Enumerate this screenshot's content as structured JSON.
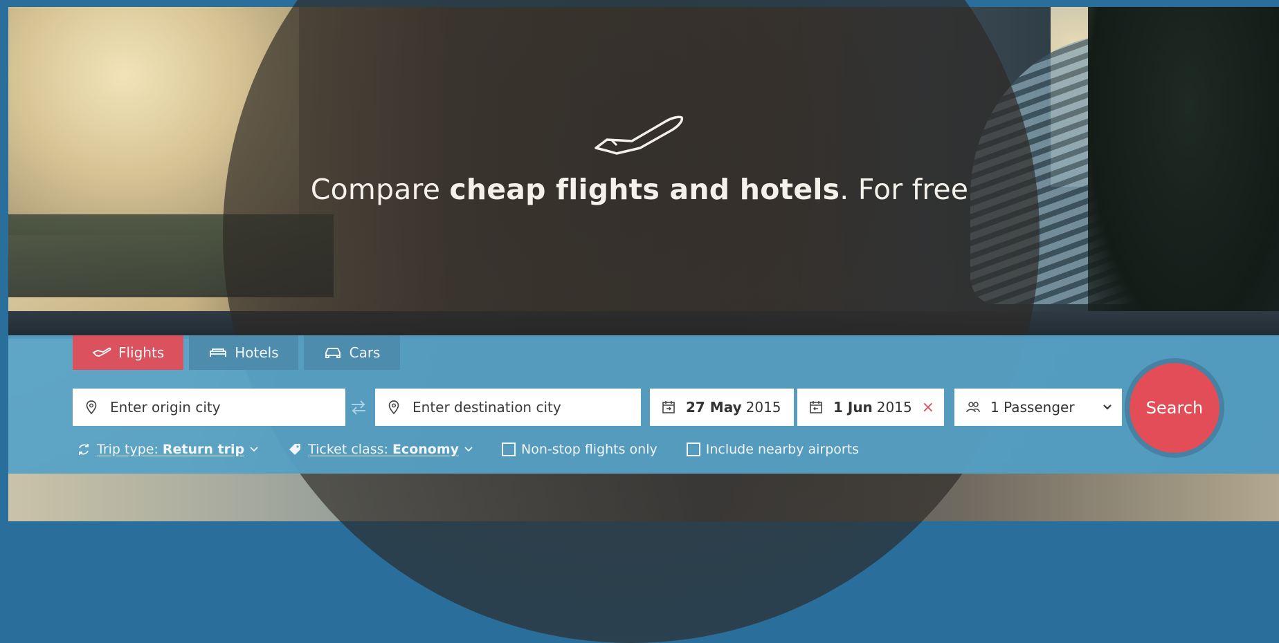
{
  "hero": {
    "headline_light_1": "Compare ",
    "headline_bold": "cheap flights and hotels",
    "headline_light_2": ". For free"
  },
  "tabs": [
    {
      "label": "Flights",
      "icon": "plane-icon",
      "active": true
    },
    {
      "label": "Hotels",
      "icon": "bed-icon",
      "active": false
    },
    {
      "label": "Cars",
      "icon": "car-icon",
      "active": false
    }
  ],
  "search": {
    "origin_placeholder": "Enter origin city",
    "destination_placeholder": "Enter destination city",
    "depart_day": "27 May",
    "depart_year": "2015",
    "return_day": "1 Jun",
    "return_year": "2015",
    "clear_symbol": "×",
    "passengers": "1 Passenger",
    "search_label": "Search"
  },
  "options": {
    "trip_type_prefix": "Trip type: ",
    "trip_type_value": "Return trip",
    "ticket_class_prefix": "Ticket class: ",
    "ticket_class_value": "Economy",
    "nonstop_label": "Non-stop flights only",
    "nearby_label": "Include nearby airports"
  },
  "colors": {
    "panel": "#57a4c9",
    "tab_active": "#d9525e",
    "tab_inactive": "#4d8cad",
    "search_button": "#e24d58"
  }
}
